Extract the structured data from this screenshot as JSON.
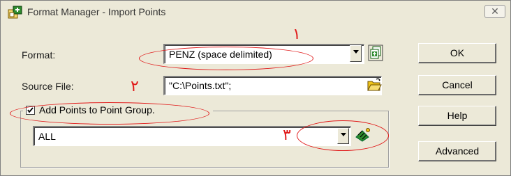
{
  "window": {
    "title": "Format Manager - Import Points",
    "close_label": "✕"
  },
  "format": {
    "label": "Format:",
    "value": "PENZ (space delimited)"
  },
  "source_file": {
    "label": "Source File:",
    "value": "\"C:\\Points.txt\";"
  },
  "point_group": {
    "checkbox_label": "Add Points to Point Group.",
    "checked": true,
    "value": "ALL"
  },
  "buttons": {
    "ok": "OK",
    "cancel": "Cancel",
    "help": "Help",
    "advanced": "Advanced"
  },
  "annotations": {
    "num1": "١",
    "num2": "٢",
    "num3": "٣",
    "color": "#e01818"
  },
  "icons": {
    "app": "format-manager-icon",
    "format_edit": "edit-format-icon",
    "browse": "folder-open-icon",
    "point_group": "point-group-icon"
  }
}
